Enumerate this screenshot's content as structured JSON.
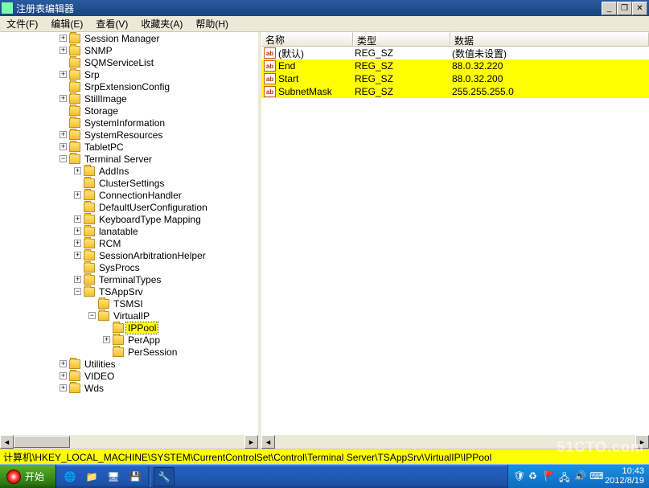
{
  "titlebar": {
    "title": "注册表编辑器"
  },
  "menu": {
    "file": "文件(F)",
    "edit": "编辑(E)",
    "view": "查看(V)",
    "favorites": "收藏夹(A)",
    "help": "帮助(H)"
  },
  "tree": {
    "nodes": [
      {
        "indent": 4,
        "expander": "+",
        "label": "Session Manager"
      },
      {
        "indent": 4,
        "expander": "+",
        "label": "SNMP"
      },
      {
        "indent": 4,
        "expander": "",
        "label": "SQMServiceList"
      },
      {
        "indent": 4,
        "expander": "+",
        "label": "Srp"
      },
      {
        "indent": 4,
        "expander": "",
        "label": "SrpExtensionConfig"
      },
      {
        "indent": 4,
        "expander": "+",
        "label": "StillImage"
      },
      {
        "indent": 4,
        "expander": "",
        "label": "Storage"
      },
      {
        "indent": 4,
        "expander": "",
        "label": "SystemInformation"
      },
      {
        "indent": 4,
        "expander": "+",
        "label": "SystemResources"
      },
      {
        "indent": 4,
        "expander": "+",
        "label": "TabletPC"
      },
      {
        "indent": 4,
        "expander": "-",
        "label": "Terminal Server"
      },
      {
        "indent": 5,
        "expander": "+",
        "label": "AddIns"
      },
      {
        "indent": 5,
        "expander": "",
        "label": "ClusterSettings"
      },
      {
        "indent": 5,
        "expander": "+",
        "label": "ConnectionHandler"
      },
      {
        "indent": 5,
        "expander": "",
        "label": "DefaultUserConfiguration"
      },
      {
        "indent": 5,
        "expander": "+",
        "label": "KeyboardType Mapping"
      },
      {
        "indent": 5,
        "expander": "+",
        "label": "lanatable"
      },
      {
        "indent": 5,
        "expander": "+",
        "label": "RCM"
      },
      {
        "indent": 5,
        "expander": "+",
        "label": "SessionArbitrationHelper"
      },
      {
        "indent": 5,
        "expander": "",
        "label": "SysProcs"
      },
      {
        "indent": 5,
        "expander": "+",
        "label": "TerminalTypes"
      },
      {
        "indent": 5,
        "expander": "-",
        "label": "TSAppSrv"
      },
      {
        "indent": 6,
        "expander": "",
        "label": "TSMSI"
      },
      {
        "indent": 6,
        "expander": "-",
        "label": "VirtualIP"
      },
      {
        "indent": 7,
        "expander": "",
        "label": "IPPool",
        "selected": true
      },
      {
        "indent": 7,
        "expander": "+",
        "label": "PerApp"
      },
      {
        "indent": 7,
        "expander": "",
        "label": "PerSession"
      },
      {
        "indent": 4,
        "expander": "+",
        "label": "Utilities"
      },
      {
        "indent": 4,
        "expander": "+",
        "label": "VIDEO"
      },
      {
        "indent": 4,
        "expander": "+",
        "label": "Wds"
      }
    ]
  },
  "list": {
    "col_name": "名称",
    "col_type": "类型",
    "col_data": "数据",
    "rows": [
      {
        "name": "(默认)",
        "type": "REG_SZ",
        "data": "(数值未设置)",
        "highlight": false
      },
      {
        "name": "End",
        "type": "REG_SZ",
        "data": "88.0.32.220",
        "highlight": true
      },
      {
        "name": "Start",
        "type": "REG_SZ",
        "data": "88.0.32.200",
        "highlight": true
      },
      {
        "name": "SubnetMask",
        "type": "REG_SZ",
        "data": "255.255.255.0",
        "highlight": true
      }
    ]
  },
  "status": {
    "path": "计算机\\HKEY_LOCAL_MACHINE\\SYSTEM\\CurrentControlSet\\Control\\Terminal Server\\TSAppSrv\\VirtualIP\\IPPool"
  },
  "taskbar": {
    "start": "开始",
    "time": "10:43",
    "date": "2012/8/19"
  },
  "watermark": "51CTO.com"
}
